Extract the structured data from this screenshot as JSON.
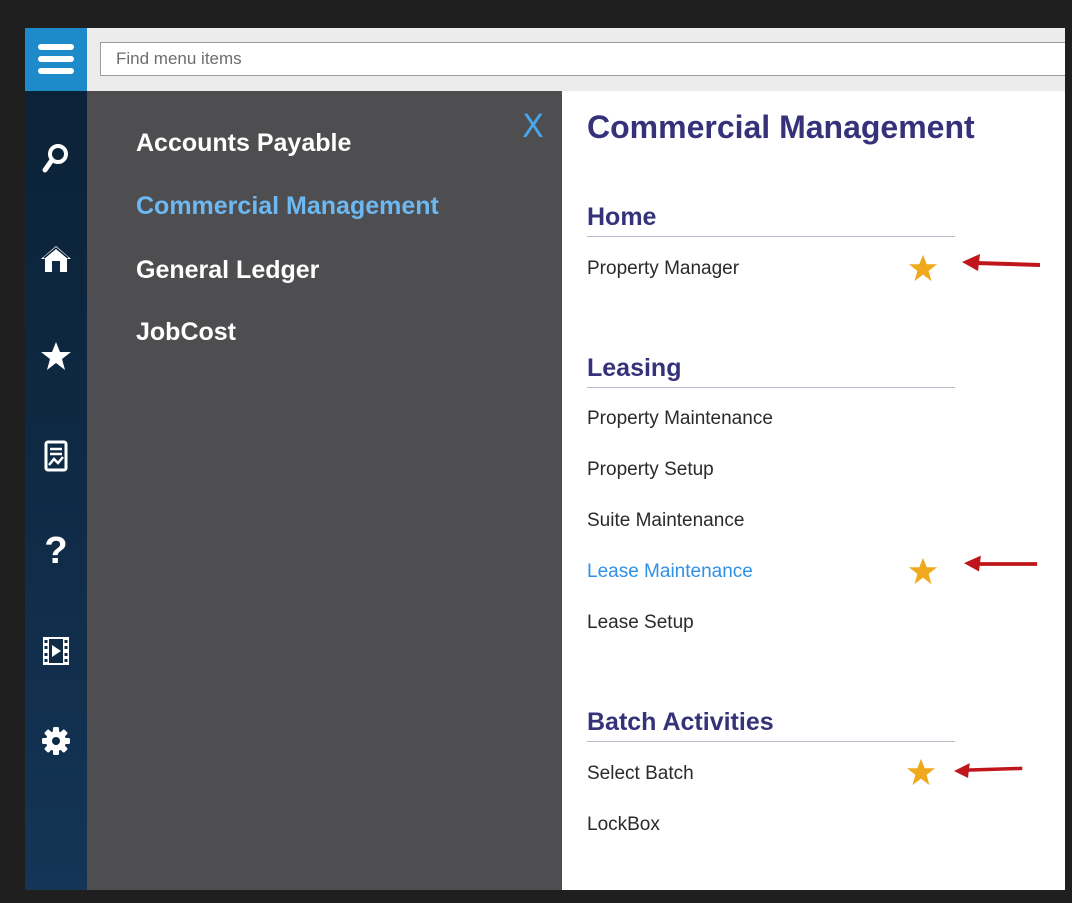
{
  "search": {
    "placeholder": "Find menu items"
  },
  "rail": {
    "items": [
      {
        "icon": "search-icon"
      },
      {
        "icon": "home-icon"
      },
      {
        "icon": "star-icon"
      },
      {
        "icon": "report-icon"
      },
      {
        "icon": "help-icon",
        "glyph": "?"
      },
      {
        "icon": "video-icon"
      },
      {
        "icon": "gear-icon"
      }
    ]
  },
  "sidemenu": {
    "close_label": "X",
    "items": [
      {
        "label": "Accounts Payable"
      },
      {
        "label": "Commercial Management",
        "active": true
      },
      {
        "label": "General Ledger"
      },
      {
        "label": "JobCost"
      }
    ]
  },
  "content": {
    "title": "Commercial Management",
    "sections": [
      {
        "title": "Home",
        "items": [
          {
            "label": "Property Manager",
            "favorite": true
          }
        ]
      },
      {
        "title": "Leasing",
        "items": [
          {
            "label": "Property Maintenance"
          },
          {
            "label": "Property Setup"
          },
          {
            "label": "Suite Maintenance"
          },
          {
            "label": "Lease Maintenance",
            "favorite": true,
            "active": true
          },
          {
            "label": "Lease Setup"
          }
        ]
      },
      {
        "title": "Batch Activities",
        "items": [
          {
            "label": "Select Batch",
            "favorite": true
          },
          {
            "label": "LockBox"
          }
        ]
      }
    ]
  },
  "colors": {
    "accent": "#1d8ac9",
    "title": "#35327a",
    "link_active": "#2f90e8",
    "star": "#f0a81c",
    "arrow": "#c0161b"
  }
}
